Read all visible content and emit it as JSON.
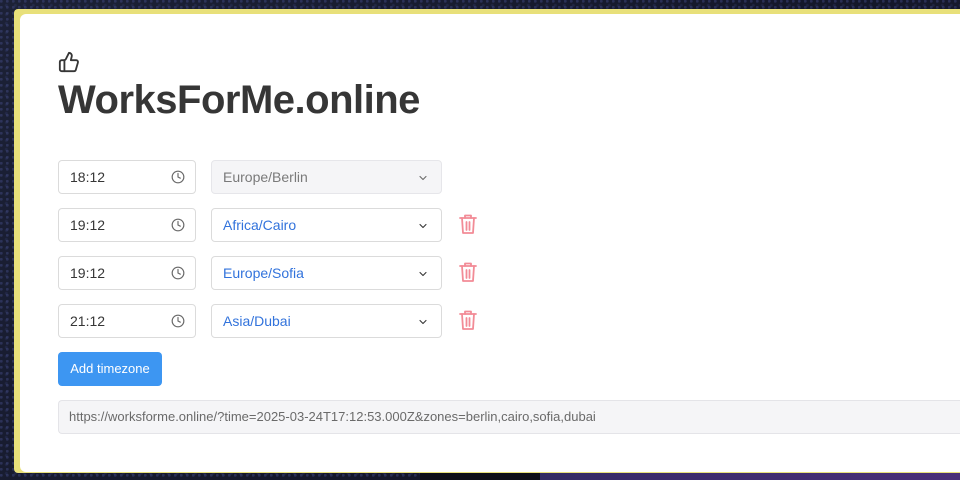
{
  "app": {
    "title": "WorksForMe.online",
    "logo_icon": "thumbs-up-icon"
  },
  "rows": [
    {
      "time": "18:12",
      "timezone": "Europe/Berlin",
      "removable": false
    },
    {
      "time": "19:12",
      "timezone": "Africa/Cairo",
      "removable": true
    },
    {
      "time": "19:12",
      "timezone": "Europe/Sofia",
      "removable": true
    },
    {
      "time": "21:12",
      "timezone": "Asia/Dubai",
      "removable": true
    }
  ],
  "actions": {
    "add_label": "Add timezone"
  },
  "share": {
    "url": "https://worksforme.online/?time=2025-03-24T17:12:53.000Z&zones=berlin,cairo,sofia,dubai"
  },
  "colors": {
    "accent": "#3d96f2",
    "link": "#3273dc",
    "delete": "#f14668",
    "title": "#363636"
  },
  "icons": {
    "time": "clock-icon",
    "select": "chevron-down-icon",
    "remove": "trash-icon"
  }
}
